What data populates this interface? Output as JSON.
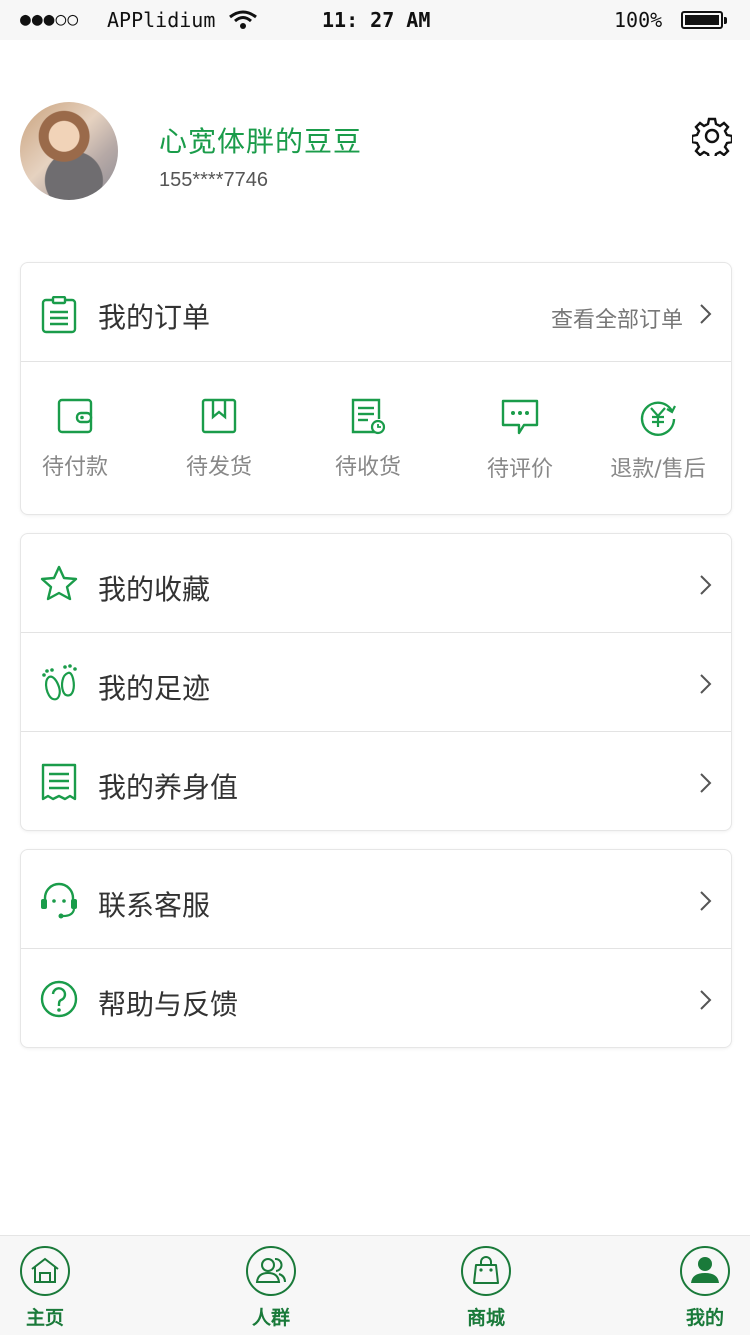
{
  "status_bar": {
    "signal": "●●●○○",
    "carrier": "APPlidium",
    "time": "11: 27 AM",
    "battery": "100%",
    "battery_level": 1.0
  },
  "profile": {
    "name": "心宽体胖的豆豆",
    "phone": "155****7746",
    "avatar_icon": "user-avatar-photo",
    "settings_icon": "gear-icon"
  },
  "orders": {
    "title": "我的订单",
    "view_all": "查看全部订单",
    "statuses": [
      {
        "label": "待付款",
        "icon": "wallet-icon"
      },
      {
        "label": "待发货",
        "icon": "package-icon"
      },
      {
        "label": "待收货",
        "icon": "receipt-clock-icon"
      },
      {
        "label": "待评价",
        "icon": "comment-icon"
      },
      {
        "label": "退款/售后",
        "icon": "refund-yen-icon"
      }
    ]
  },
  "menu_group_1": [
    {
      "label": "我的收藏",
      "icon": "star-icon"
    },
    {
      "label": "我的足迹",
      "icon": "footprint-icon"
    },
    {
      "label": "我的养身值",
      "icon": "receipt-icon"
    }
  ],
  "menu_group_2": [
    {
      "label": "联系客服",
      "icon": "headset-icon"
    },
    {
      "label": "帮助与反馈",
      "icon": "question-icon"
    }
  ],
  "tabbar": [
    {
      "label": "主页",
      "icon": "home-icon"
    },
    {
      "label": "人群",
      "icon": "people-icon"
    },
    {
      "label": "商城",
      "icon": "shopping-bag-icon"
    },
    {
      "label": "我的",
      "icon": "person-icon",
      "active": true
    }
  ],
  "colors": {
    "accent": "#1a9c4a",
    "tab_text": "#1a7a3a"
  }
}
